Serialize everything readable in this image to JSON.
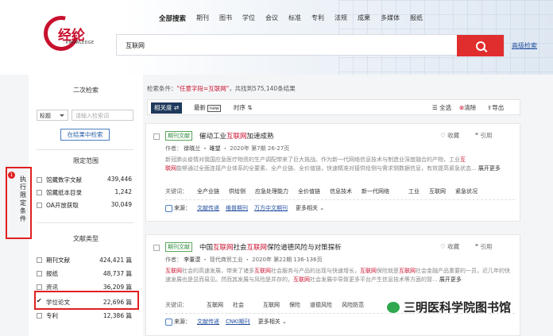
{
  "header": {
    "logo_text": "经纶",
    "logo_sub": "KNOWLEDGE",
    "nav": [
      "全部搜索",
      "期刊",
      "图书",
      "学位",
      "会议",
      "标准",
      "专利",
      "法规",
      "成果",
      "多媒体",
      "报纸"
    ],
    "search_value": "互联网",
    "advanced_label": "高级检索"
  },
  "sidebar": {
    "secondary_search": "二次检索",
    "field_select": "标题",
    "keyword_placeholder": "请输入检索词",
    "in_results_button": "在结果中检索",
    "scope_title": "限定范围",
    "scope": [
      {
        "label": "馆藏数字文献",
        "count": "439,446"
      },
      {
        "label": "馆藏纸本目录",
        "count": "1,242"
      },
      {
        "label": "OA开放获取",
        "count": "30,049"
      }
    ],
    "type_title": "文献类型",
    "types": [
      {
        "label": "期刊文献",
        "count": "424,421 篇"
      },
      {
        "label": "报纸",
        "count": "48,737 篇"
      },
      {
        "label": "资讯",
        "count": "36,209 篇"
      },
      {
        "label": "学位论文",
        "count": "22,696 篇"
      },
      {
        "label": "专利",
        "count": "12,386 篇"
      }
    ],
    "annotation_number": "1",
    "annotation_text": "执行限定条件"
  },
  "results": {
    "cond_prefix": "检索条件：",
    "cond_value": "\"任意字段=互联网\"",
    "cond_suffix": "，共找到575,140条结果",
    "sort": [
      "相关度 ⇄",
      "最新",
      "new",
      "时序"
    ],
    "tools": [
      "全选",
      "清除",
      "导出"
    ],
    "items": [
      {
        "type": "期刊文献",
        "title_pre": "催动工业",
        "title_hl": "互联网",
        "title_post": "加速成熟",
        "fav": "收藏",
        "cite": "引用",
        "meta_author_label": "作者：",
        "meta_authors": "徐晓兰 ・ 雎望",
        "meta_rest": "・ 2020年 第7期 26-27页",
        "abstract_a": "新冠肺炎疫情对我国应急医疗物资的生产调配带来了巨大挑战。作为新一代网络信息技术与制造业深度融合的产物，工业",
        "abstract_hl1": "互",
        "abstract_hl2": "联网",
        "abstract_b": "能够通过全面连接产业体系的全要素、全产业链、全价值链，快速精准对接供给侧与需求侧数据信息，有效提高紧急状态... ",
        "expand": "展开更多",
        "kw_label": "关键词：",
        "keywords": [
          "全产业链",
          "供给侧",
          "应急处理能力",
          "全价值链",
          "信息技术",
          "新一代网络"
        ],
        "kw_hl_pre": "工业",
        "kw_hl": "互联网",
        "kw_last": "紧急状况",
        "src_label": "来源：",
        "sources": [
          "文献传递",
          "维普期刊",
          "万方中文期刊"
        ],
        "more": "更多相关"
      },
      {
        "type": "期刊文献",
        "title_pre": "中国",
        "title_hl": "互联网",
        "title_mid": "社会",
        "title_hl2": "互联网",
        "title_post": "保险道德风险与对策探析",
        "fav": "收藏",
        "cite": "引用",
        "meta_author_label": "作者：",
        "meta_authors": "李董漠",
        "meta_rest": "・ 现代商贸工业 ・ 2020年 第22期 136-136页",
        "abstract_hl_a": "互联网",
        "abstract_a": "社会的高速发展，带来了诸多",
        "abstract_hl_b": "互联网",
        "abstract_b": "社会服务与产品的出现与快速增长，",
        "abstract_hl_c": "互联网",
        "abstract_c": "保险就是",
        "abstract_hl_d": "互联网",
        "abstract_d": "社会金融产品重要的一员，近几年的快速发展也是显而易见。然而其发展与风险是并存的，",
        "abstract_hl_e": "互联网",
        "abstract_e": "社会发展中导致更多平台产生信息技术等方面的冒... ",
        "expand": "展开更多",
        "kw_label": "关键词：",
        "kw1_hl": "互联网",
        "kw1_rest": "社会",
        "kw2_hl": "互联网",
        "kw2_rest": "保险",
        "keywords": [
          "道德风险",
          "风险防范"
        ],
        "src_label": "来源：",
        "sources": [
          "文献传递",
          "CNKI期刊"
        ],
        "more": "更多相关"
      }
    ]
  },
  "watermark": "三明医科学院图书馆"
}
